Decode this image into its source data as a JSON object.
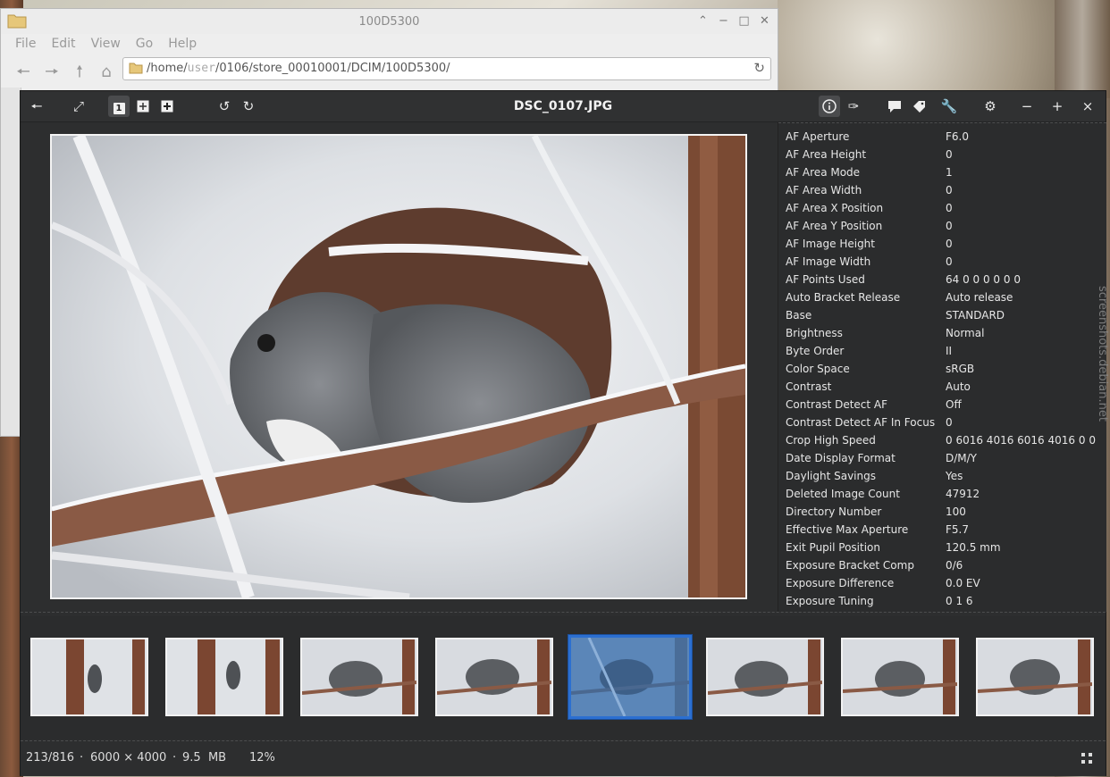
{
  "file_manager": {
    "title": "100D5300",
    "menu": [
      "File",
      "Edit",
      "View",
      "Go",
      "Help"
    ],
    "path_prefix": "/home/",
    "path_user": "user",
    "path_suffix": "/0106/store_00010001/DCIM/100D5300/"
  },
  "viewer": {
    "title": "DSC_0107.JPG",
    "toolbar": {
      "back_icon": "arrow-left-icon",
      "fullscreen_icon": "expand-icon",
      "view_single_label": "1",
      "rotate_left_icon": "rotate-ccw-icon",
      "rotate_right_icon": "rotate-cw-icon",
      "info_icon": "info-icon",
      "edit_icon": "brush-icon",
      "comment_icon": "speech-bubble-icon",
      "tag_icon": "tag-icon",
      "tools_icon": "wrench-icon",
      "settings_icon": "gear-icon",
      "minimize_label": "−",
      "maximize_label": "+",
      "close_label": "×"
    },
    "metadata": [
      {
        "key": "AF Aperture",
        "value": "F6.0"
      },
      {
        "key": "AF Area Height",
        "value": "0"
      },
      {
        "key": "AF Area Mode",
        "value": "1"
      },
      {
        "key": "AF Area Width",
        "value": "0"
      },
      {
        "key": "AF Area X Position",
        "value": "0"
      },
      {
        "key": "AF Area Y Position",
        "value": "0"
      },
      {
        "key": "AF Image Height",
        "value": "0"
      },
      {
        "key": "AF Image Width",
        "value": "0"
      },
      {
        "key": "AF Points Used",
        "value": "64 0 0 0 0 0 0"
      },
      {
        "key": "Auto Bracket Release",
        "value": "Auto release"
      },
      {
        "key": "Base",
        "value": "STANDARD"
      },
      {
        "key": "Brightness",
        "value": "Normal"
      },
      {
        "key": "Byte Order",
        "value": "II"
      },
      {
        "key": "Color Space",
        "value": "sRGB"
      },
      {
        "key": "Contrast",
        "value": "Auto"
      },
      {
        "key": "Contrast Detect AF",
        "value": "Off"
      },
      {
        "key": "Contrast Detect AF In Focus",
        "value": "0"
      },
      {
        "key": "Crop High Speed",
        "value": "0 6016 4016 6016 4016 0 0"
      },
      {
        "key": "Date Display Format",
        "value": "D/M/Y"
      },
      {
        "key": "Daylight Savings",
        "value": "Yes"
      },
      {
        "key": "Deleted Image Count",
        "value": "47912"
      },
      {
        "key": "Directory Number",
        "value": "100"
      },
      {
        "key": "Effective Max Aperture",
        "value": "F5.7"
      },
      {
        "key": "Exit Pupil Position",
        "value": "120.5 mm"
      },
      {
        "key": "Exposure Bracket Comp",
        "value": "0/6"
      },
      {
        "key": "Exposure Difference",
        "value": "0.0 EV"
      },
      {
        "key": "Exposure Tuning",
        "value": "0 1 6"
      }
    ],
    "status": {
      "position": "213/816",
      "sep1": "·",
      "dimensions": "6000 × 4000",
      "sep2": "·",
      "size": "9.5  MB",
      "zoom": "12%"
    }
  },
  "watermark": "screenshots.debian.net"
}
